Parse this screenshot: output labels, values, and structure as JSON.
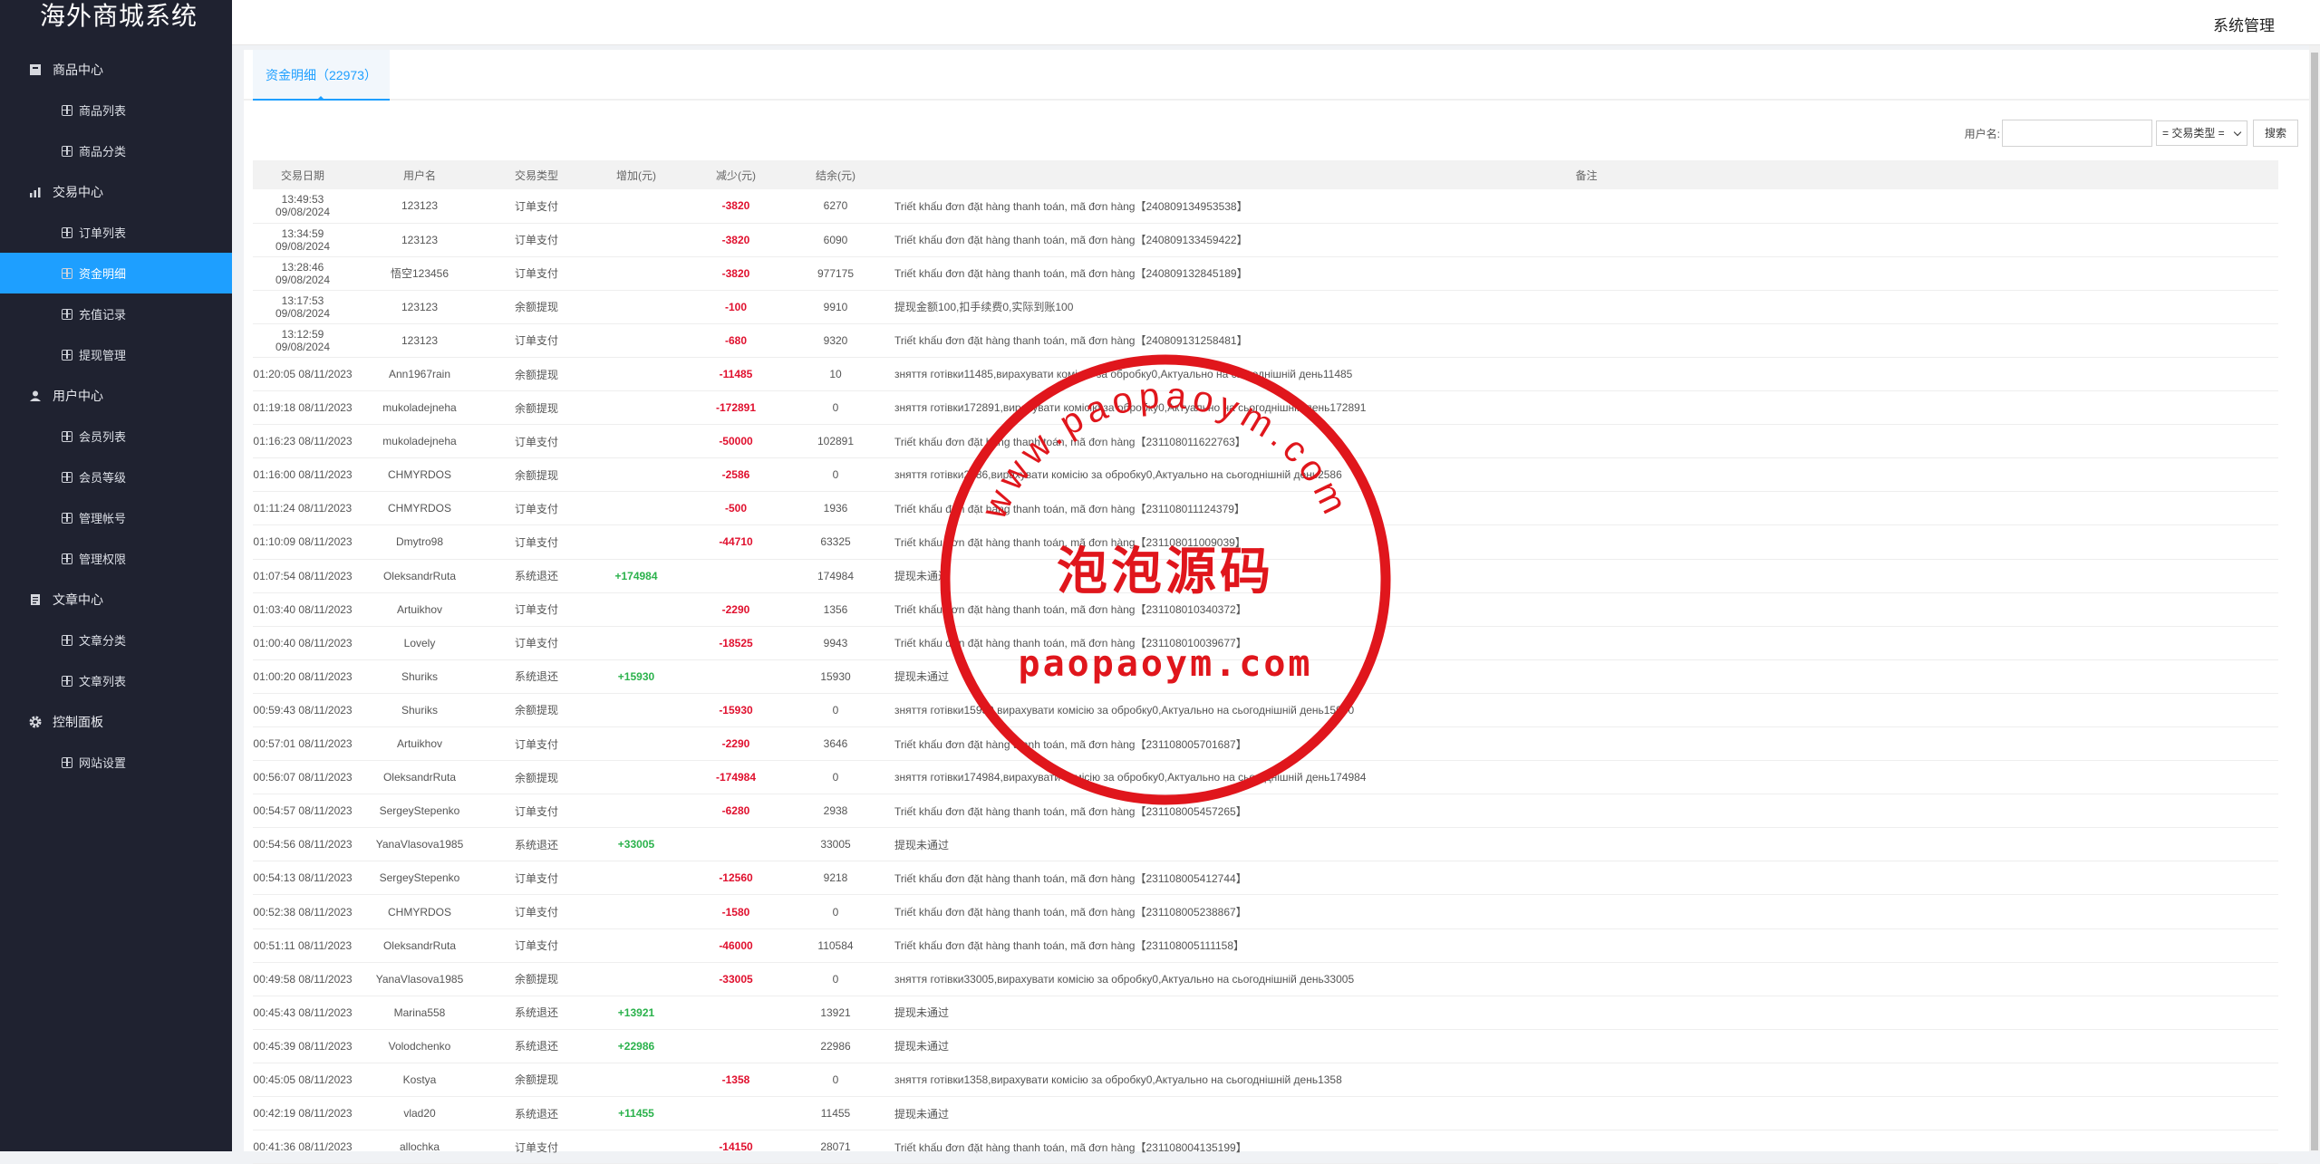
{
  "brand": "海外商城系统",
  "topbar": {
    "system": "系统管理"
  },
  "nav": [
    {
      "type": "group",
      "label": "商品中心",
      "icon": "box-icon"
    },
    {
      "type": "item",
      "label": "商品列表"
    },
    {
      "type": "item",
      "label": "商品分类"
    },
    {
      "type": "group",
      "label": "交易中心",
      "icon": "bar-chart-icon"
    },
    {
      "type": "item",
      "label": "订单列表"
    },
    {
      "type": "item",
      "label": "资金明细",
      "active": true
    },
    {
      "type": "item",
      "label": "充值记录"
    },
    {
      "type": "item",
      "label": "提现管理"
    },
    {
      "type": "group",
      "label": "用户中心",
      "icon": "user-icon"
    },
    {
      "type": "item",
      "label": "会员列表"
    },
    {
      "type": "item",
      "label": "会员等级"
    },
    {
      "type": "item",
      "label": "管理帐号"
    },
    {
      "type": "item",
      "label": "管理权限"
    },
    {
      "type": "group",
      "label": "文章中心",
      "icon": "document-icon"
    },
    {
      "type": "item",
      "label": "文章分类"
    },
    {
      "type": "item",
      "label": "文章列表"
    },
    {
      "type": "group",
      "label": "控制面板",
      "icon": "gear-icon"
    },
    {
      "type": "item",
      "label": "网站设置"
    }
  ],
  "tab": {
    "label": "资金明细（22973）"
  },
  "filter": {
    "username_label": "用户名:",
    "username_value": "",
    "type_select": "= 交易类型 =",
    "search": "搜索"
  },
  "table": {
    "headers": [
      "交易日期",
      "用户名",
      "交易类型",
      "增加(元)",
      "减少(元)",
      "结余(元)",
      "备注"
    ],
    "rows": [
      [
        "13:49:53 09/08/2024",
        "123123",
        "订单支付",
        "",
        "-3820",
        "6270",
        "Triết khấu đơn đặt hàng thanh toán, mã đơn hàng【240809134953538】"
      ],
      [
        "13:34:59 09/08/2024",
        "123123",
        "订单支付",
        "",
        "-3820",
        "6090",
        "Triết khấu đơn đặt hàng thanh toán, mã đơn hàng【240809133459422】"
      ],
      [
        "13:28:46 09/08/2024",
        "悟空123456",
        "订单支付",
        "",
        "-3820",
        "977175",
        "Triết khấu đơn đặt hàng thanh toán, mã đơn hàng【240809132845189】"
      ],
      [
        "13:17:53 09/08/2024",
        "123123",
        "余额提现",
        "",
        "-100",
        "9910",
        "提现金额100,扣手续费0,实际到账100"
      ],
      [
        "13:12:59 09/08/2024",
        "123123",
        "订单支付",
        "",
        "-680",
        "9320",
        "Triết khấu đơn đặt hàng thanh toán, mã đơn hàng【240809131258481】"
      ],
      [
        "01:20:05 08/11/2023",
        "Ann1967rain",
        "余额提现",
        "",
        "-11485",
        "10",
        "зняття готівки11485,вирахувати комісію за обробку0,Актуально на сьогоднішній день11485"
      ],
      [
        "01:19:18 08/11/2023",
        "mukoladejneha",
        "余额提现",
        "",
        "-172891",
        "0",
        "зняття готівки172891,вирахувати комісію за обробку0,Актуально на сьогоднішній день172891"
      ],
      [
        "01:16:23 08/11/2023",
        "mukoladejneha",
        "订单支付",
        "",
        "-50000",
        "102891",
        "Triết khấu đơn đặt hàng thanh toán, mã đơn hàng【231108011622763】"
      ],
      [
        "01:16:00 08/11/2023",
        "CHMYRDOS",
        "余额提现",
        "",
        "-2586",
        "0",
        "зняття готівки2586,вирахувати комісію за обробку0,Актуально на сьогоднішній день2586"
      ],
      [
        "01:11:24 08/11/2023",
        "CHMYRDOS",
        "订单支付",
        "",
        "-500",
        "1936",
        "Triết khấu đơn đặt hàng thanh toán, mã đơn hàng【231108011124379】"
      ],
      [
        "01:10:09 08/11/2023",
        "Dmytro98",
        "订单支付",
        "",
        "-44710",
        "63325",
        "Triết khấu đơn đặt hàng thanh toán, mã đơn hàng【231108011009039】"
      ],
      [
        "01:07:54 08/11/2023",
        "OleksandrRuta",
        "系统退还",
        "+174984",
        "",
        "174984",
        "提现未通过"
      ],
      [
        "01:03:40 08/11/2023",
        "Artuikhov",
        "订单支付",
        "",
        "-2290",
        "1356",
        "Triết khấu đơn đặt hàng thanh toán, mã đơn hàng【231108010340372】"
      ],
      [
        "01:00:40 08/11/2023",
        "Lovely",
        "订单支付",
        "",
        "-18525",
        "9943",
        "Triết khấu đơn đặt hàng thanh toán, mã đơn hàng【231108010039677】"
      ],
      [
        "01:00:20 08/11/2023",
        "Shuriks",
        "系统退还",
        "+15930",
        "",
        "15930",
        "提现未通过"
      ],
      [
        "00:59:43 08/11/2023",
        "Shuriks",
        "余额提现",
        "",
        "-15930",
        "0",
        "зняття готівки15930,вирахувати комісію за обробку0,Актуально на сьогоднішній день15930"
      ],
      [
        "00:57:01 08/11/2023",
        "Artuikhov",
        "订单支付",
        "",
        "-2290",
        "3646",
        "Triết khấu đơn đặt hàng thanh toán, mã đơn hàng【231108005701687】"
      ],
      [
        "00:56:07 08/11/2023",
        "OleksandrRuta",
        "余额提现",
        "",
        "-174984",
        "0",
        "зняття готівки174984,вирахувати комісію за обробку0,Актуально на сьогоднішній день174984"
      ],
      [
        "00:54:57 08/11/2023",
        "SergeyStepenko",
        "订单支付",
        "",
        "-6280",
        "2938",
        "Triết khấu đơn đặt hàng thanh toán, mã đơn hàng【231108005457265】"
      ],
      [
        "00:54:56 08/11/2023",
        "YanaVlasova1985",
        "系统退还",
        "+33005",
        "",
        "33005",
        "提现未通过"
      ],
      [
        "00:54:13 08/11/2023",
        "SergeyStepenko",
        "订单支付",
        "",
        "-12560",
        "9218",
        "Triết khấu đơn đặt hàng thanh toán, mã đơn hàng【231108005412744】"
      ],
      [
        "00:52:38 08/11/2023",
        "CHMYRDOS",
        "订单支付",
        "",
        "-1580",
        "0",
        "Triết khấu đơn đặt hàng thanh toán, mã đơn hàng【231108005238867】"
      ],
      [
        "00:51:11 08/11/2023",
        "OleksandrRuta",
        "订单支付",
        "",
        "-46000",
        "110584",
        "Triết khấu đơn đặt hàng thanh toán, mã đơn hàng【231108005111158】"
      ],
      [
        "00:49:58 08/11/2023",
        "YanaVlasova1985",
        "余额提现",
        "",
        "-33005",
        "0",
        "зняття готівки33005,вирахувати комісію за обробку0,Актуально на сьогоднішній день33005"
      ],
      [
        "00:45:43 08/11/2023",
        "Marina558",
        "系统退还",
        "+13921",
        "",
        "13921",
        "提现未通过"
      ],
      [
        "00:45:39 08/11/2023",
        "Volodchenko",
        "系统退还",
        "+22986",
        "",
        "22986",
        "提现未通过"
      ],
      [
        "00:45:05 08/11/2023",
        "Kostya",
        "余额提现",
        "",
        "-1358",
        "0",
        "зняття готівки1358,вирахувати комісію за обробку0,Актуально на сьогоднішній день1358"
      ],
      [
        "00:42:19 08/11/2023",
        "vlad20",
        "系统退还",
        "+11455",
        "",
        "11455",
        "提现未通过"
      ],
      [
        "00:41:36 08/11/2023",
        "allochka",
        "订单支付",
        "",
        "-14150",
        "28071",
        "Triết khấu đơn đặt hàng thanh toán, mã đơn hàng【231108004135199】"
      ]
    ]
  },
  "watermark": {
    "top_arc": "www.paopaoym.com",
    "cn_text": "泡泡源码",
    "bottom_text": "paopaoym.com",
    "color": "#e0161c"
  },
  "colors": {
    "sidebar_bg": "#1f2230",
    "active": "#1e9fff",
    "increase": "#2bb24c",
    "decrease": "#e0102e"
  }
}
